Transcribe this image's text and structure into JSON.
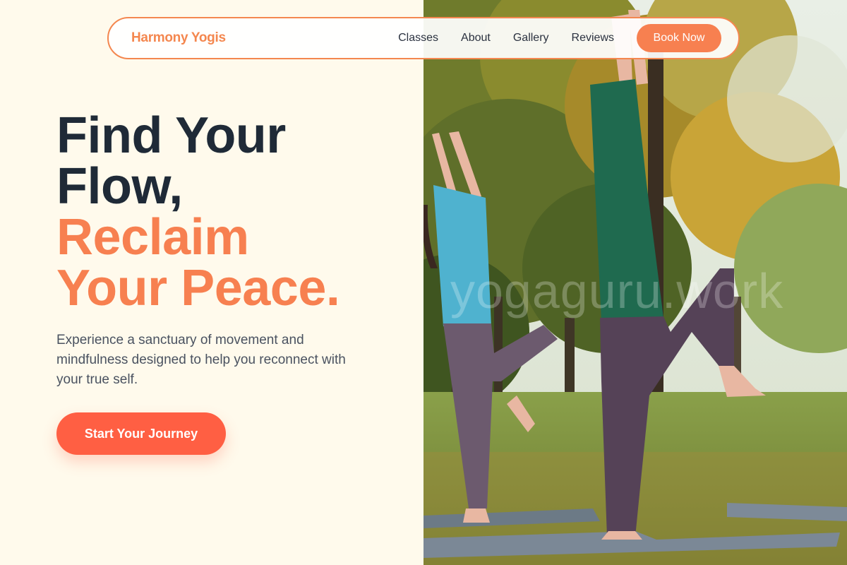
{
  "brand": {
    "name": "Harmony Yogis",
    "accent_color": "#f78050",
    "cta_color": "#ff5f43"
  },
  "nav": {
    "links": [
      "Classes",
      "About",
      "Gallery",
      "Reviews"
    ],
    "book_label": "Book Now"
  },
  "hero": {
    "headline_dark": [
      "Find Your",
      "Flow,"
    ],
    "headline_accent": [
      "Reclaim",
      "Your Peace."
    ],
    "subtext": "Experience a sanctuary of movement and mindfulness designed to help you reconnect with your true self.",
    "cta_label": "Start Your Journey"
  },
  "image": {
    "watermark_text": "yogaguru.work"
  }
}
